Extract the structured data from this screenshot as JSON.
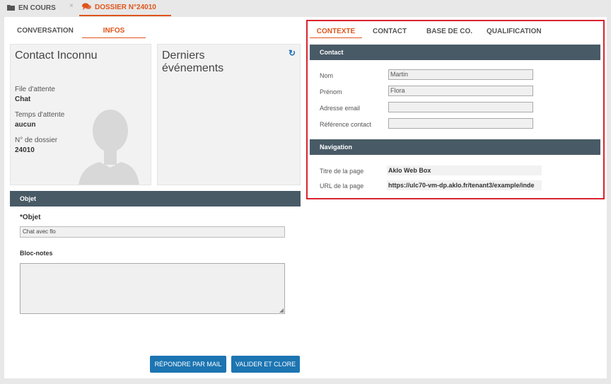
{
  "top_tabs": [
    {
      "label": "EN COURS",
      "icon": "folder-icon"
    },
    {
      "label": "DOSSIER N°24010",
      "icon": "chat-bubbles-icon"
    }
  ],
  "top_close": "×",
  "left_tabs": [
    "CONVERSATION",
    "INFOS"
  ],
  "contact_card": {
    "title": "Contact Inconnu",
    "fields": [
      {
        "label": "File d'attente",
        "value": "Chat"
      },
      {
        "label": "Temps d'attente",
        "value": "aucun"
      },
      {
        "label": "N° de dossier",
        "value": "24010"
      }
    ]
  },
  "events_card": {
    "title": "Derniers événements",
    "refresh_glyph": "↻"
  },
  "objet_section": {
    "header": "Objet",
    "objet_label": "*Objet",
    "objet_value": "Chat avec flo",
    "notes_label": "Bloc-notes",
    "notes_value": ""
  },
  "buttons": {
    "reply_mail": "RÉPONDRE PAR MAIL",
    "validate_close": "VALIDER ET CLORE"
  },
  "right_tabs": [
    "CONTEXTE",
    "CONTACT",
    "BASE DE CO.",
    "QUALIFICATION"
  ],
  "contact_section": {
    "header": "Contact",
    "fields": [
      {
        "label": "Nom",
        "value": "Martin"
      },
      {
        "label": "Prénom",
        "value": "Flora"
      },
      {
        "label": "Adresse email",
        "value": ""
      },
      {
        "label": "Référence contact",
        "value": ""
      }
    ]
  },
  "navigation_section": {
    "header": "Navigation",
    "fields": [
      {
        "label": "Titre de la page",
        "value": "Aklo Web Box"
      },
      {
        "label": "URL de la page",
        "value": "https://ulc70-vm-dp.aklo.fr/tenant3/example/inde"
      }
    ]
  },
  "colors": {
    "accent": "#e0541b",
    "header_bg": "#485a66",
    "button": "#1c75b2",
    "highlight": "#d9232e"
  }
}
